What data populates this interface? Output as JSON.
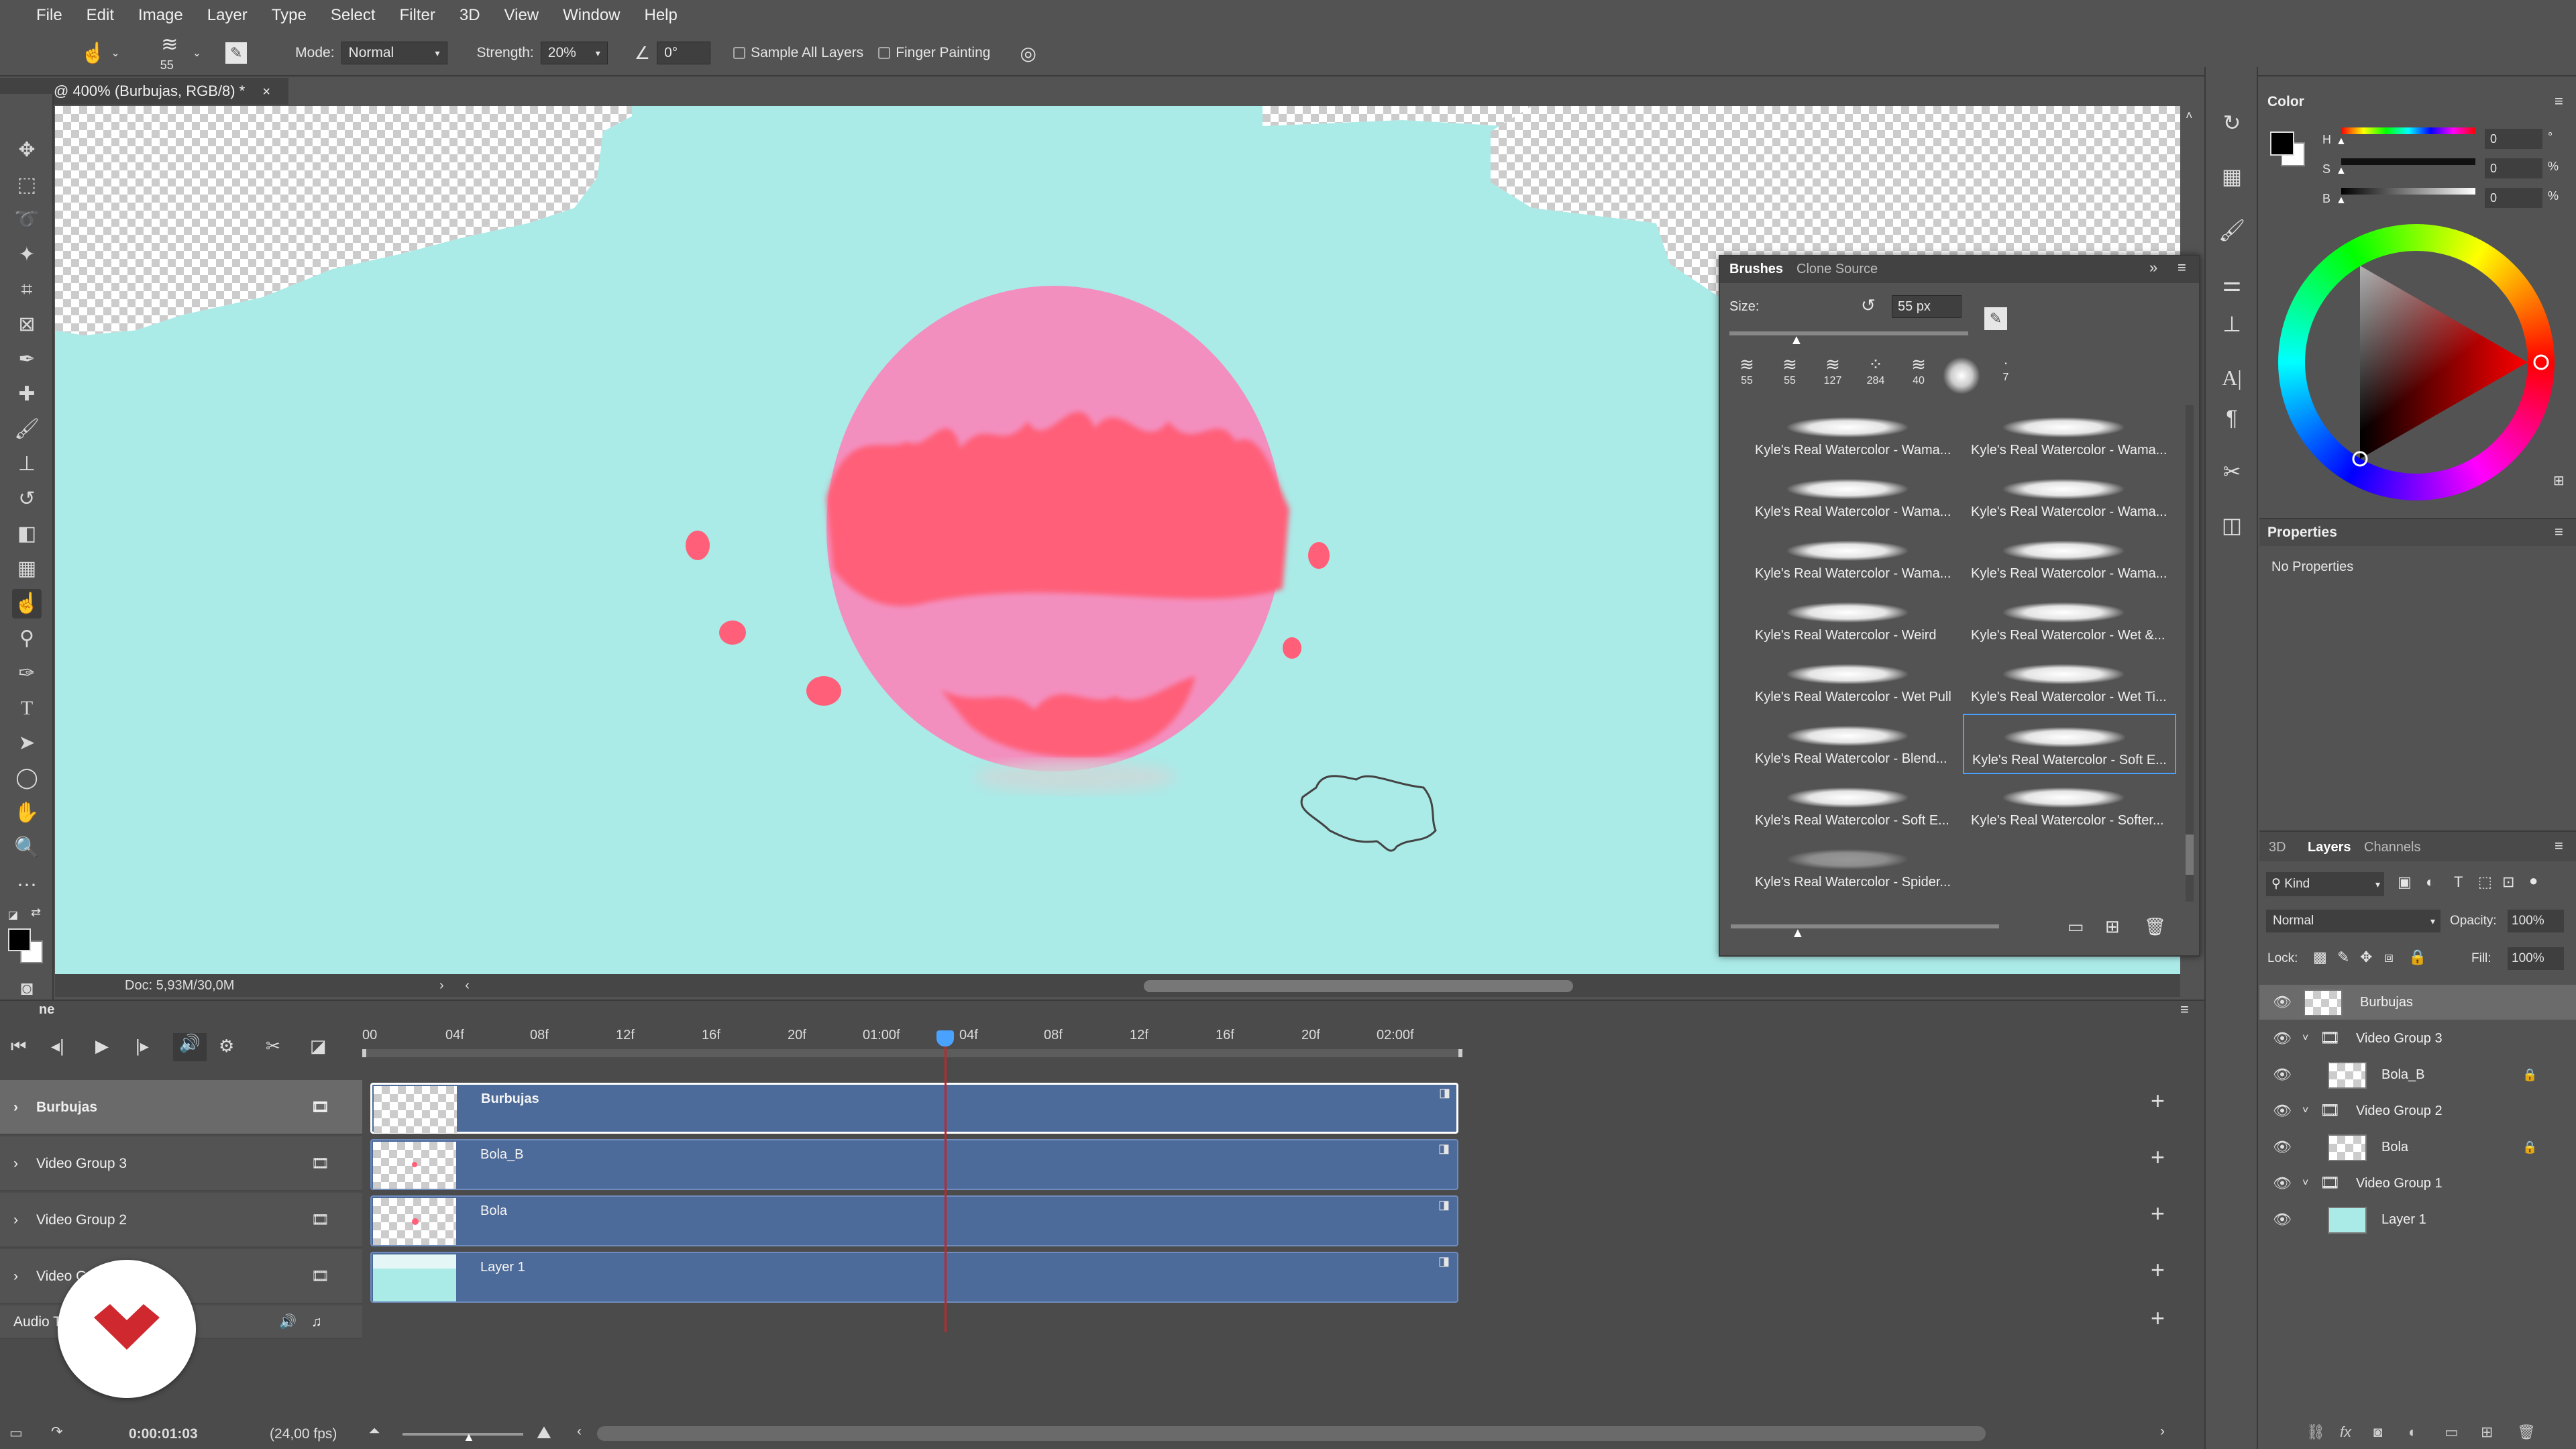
{
  "menu": [
    "File",
    "Edit",
    "Image",
    "Layer",
    "Type",
    "Select",
    "Filter",
    "3D",
    "View",
    "Window",
    "Help"
  ],
  "options": {
    "brush_size": "55",
    "mode_label": "Mode:",
    "mode_value": "Normal",
    "strength_label": "Strength:",
    "strength_value": "20%",
    "angle_value": "0°",
    "sample_all_layers": "Sample All Layers",
    "finger_painting": "Finger Painting"
  },
  "document": {
    "tab_title": "@ 400% (Burbujas, RGB/8) *",
    "doc_info": "Doc: 5,93M/30,0M"
  },
  "brushes_panel": {
    "tab_brushes": "Brushes",
    "tab_clone_source": "Clone Source",
    "size_label": "Size:",
    "size_value": "55 px",
    "recent_sizes": [
      "55",
      "55",
      "127",
      "284",
      "40",
      "7"
    ],
    "items": [
      "Kyle's Real Watercolor - Wama...",
      "Kyle's Real Watercolor - Wama...",
      "Kyle's Real Watercolor - Wama...",
      "Kyle's Real Watercolor - Wama...",
      "Kyle's Real Watercolor - Wama...",
      "Kyle's Real Watercolor - Wama...",
      "Kyle's Real Watercolor - Weird",
      "Kyle's Real Watercolor - Wet &...",
      "Kyle's Real Watercolor - Wet Pull",
      "Kyle's Real Watercolor - Wet Ti...",
      "Kyle's Real Watercolor - Blend...",
      "Kyle's Real Watercolor - Soft E...",
      "Kyle's Real Watercolor - Soft E...",
      "Kyle's Real Watercolor - Softer...",
      "Kyle's Real Watercolor - Spider..."
    ],
    "selected_index": 11
  },
  "color_panel": {
    "title": "Color",
    "h_label": "H",
    "h_value": "0",
    "h_unit": "°",
    "s_label": "S",
    "s_value": "0",
    "s_unit": "%",
    "b_label": "B",
    "b_value": "0",
    "b_unit": "%"
  },
  "properties_panel": {
    "title": "Properties",
    "body": "No Properties"
  },
  "layers_panel": {
    "tab_3d": "3D",
    "tab_layers": "Layers",
    "tab_channels": "Channels",
    "filter_kind": "Kind",
    "blend_mode": "Normal",
    "opacity_label": "Opacity:",
    "opacity_value": "100%",
    "lock_label": "Lock:",
    "fill_label": "Fill:",
    "fill_value": "100%",
    "layers": [
      "Burbujas",
      "Video Group 3",
      "Bola_B",
      "Video Group 2",
      "Bola",
      "Video Group 1",
      "Layer 1"
    ]
  },
  "timeline": {
    "tab_label": "ne",
    "ruler": [
      "00",
      "04f",
      "08f",
      "12f",
      "16f",
      "20f",
      "01:00f",
      "04f",
      "08f",
      "12f",
      "16f",
      "20f",
      "02:00f"
    ],
    "tracks": [
      "Burbujas",
      "Video Group 3",
      "Video Group 2",
      "Video G"
    ],
    "clips": [
      "Burbujas",
      "Bola_B",
      "Bola",
      "Layer 1"
    ],
    "audio_label": "Audio T",
    "current_time": "0:00:01:03",
    "fps": "(24,00 fps)"
  },
  "colors": {
    "canvas_bg": "#aaeae7",
    "bubble_pink": "#f38fbf",
    "bubble_red": "#ff5f78",
    "clip_blue": "#4d6b9a",
    "selection_blue": "#4aa2ff",
    "playhead_red": "#c0272d",
    "watermark_red": "#d0282f"
  }
}
